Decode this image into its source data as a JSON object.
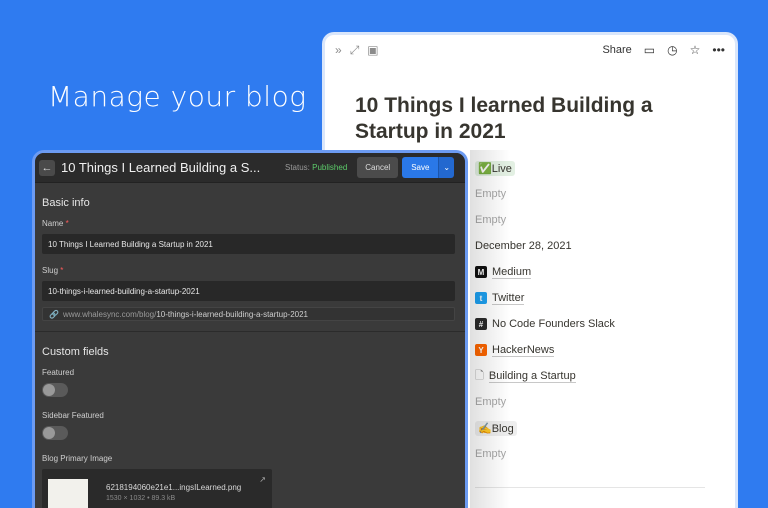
{
  "hero": {
    "text": "Manage your blog"
  },
  "notion": {
    "toolbar": {
      "share": "Share"
    },
    "title": "10 Things I learned Building a Startup in 2021",
    "properties": {
      "status": "✅Live",
      "empty1": "Empty",
      "empty2": "Empty",
      "date": "December 28, 2021",
      "link1": "Medium",
      "link2": "Twitter",
      "link3": "No Code Founders Slack",
      "link4": "HackerNews",
      "page": "Building a Startup",
      "empty3": "Empty",
      "category": "✍️Blog",
      "empty4": "Empty"
    },
    "icon_colors": {
      "medium": "#111111",
      "twitter": "#1da1f2",
      "slack": "#2b2b2b",
      "hackernews": "#ff6600"
    }
  },
  "editor": {
    "title": "10 Things I Learned Building a S...",
    "status_label": "Status:",
    "status_value": "Published",
    "cancel": "Cancel",
    "save": "Save",
    "basic_info": "Basic info",
    "name_label": "Name",
    "name_value": "10 Things I Learned Building a Startup in 2021",
    "slug_label": "Slug",
    "slug_value": "10-things-i-learned-building-a-startup-2021",
    "url_prefix": "www.whalesync.com/blog/",
    "url_path": "10-things-i-learned-building-a-startup-2021",
    "custom_fields": "Custom fields",
    "featured_label": "Featured",
    "sidebar_featured_label": "Sidebar Featured",
    "image_label": "Blog Primary Image",
    "image_name": "6218194060e21e1...ingsILearned.png",
    "image_size": "1530 × 1032 • 89.3 kB",
    "required_mark": "*"
  }
}
